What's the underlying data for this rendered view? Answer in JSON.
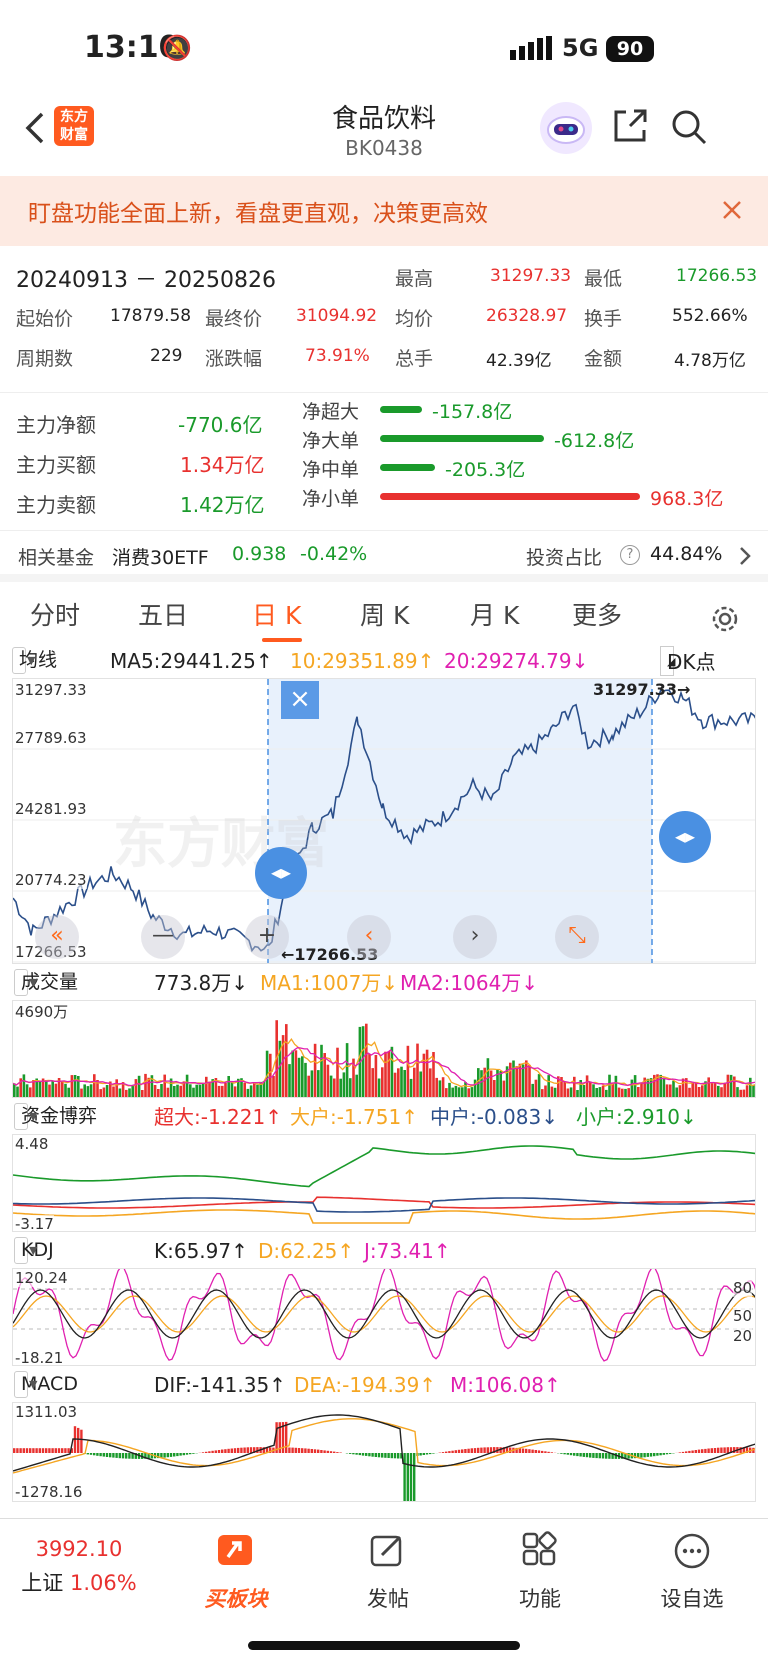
{
  "status_bar": {
    "time": "13:10",
    "network": "5G",
    "battery": "90"
  },
  "nav": {
    "title": "食品饮料",
    "code": "BK0438",
    "logo_line1": "东方",
    "logo_line2": "财富"
  },
  "banner": {
    "text": "盯盘功能全面上新，看盘更直观，决策更高效"
  },
  "stats": {
    "date_range": "20240913 － 20250826",
    "high_label": "最高",
    "high": "31297.33",
    "low_label": "最低",
    "low": "17266.53",
    "start_label": "起始价",
    "start": "17879.58",
    "end_label": "最终价",
    "end": "31094.92",
    "avg_label": "均价",
    "avg": "26328.97",
    "turnover_label": "换手",
    "turnover": "552.66%",
    "periods_label": "周期数",
    "periods": "229",
    "change_label": "涨跌幅",
    "change": "73.91%",
    "volume_label": "总手",
    "volume": "42.39亿",
    "amount_label": "金额",
    "amount": "4.78万亿"
  },
  "flows": {
    "main_net_label": "主力净额",
    "main_net": "-770.6亿",
    "main_buy_label": "主力买额",
    "main_buy": "1.34万亿",
    "main_sell_label": "主力卖额",
    "main_sell": "1.42万亿",
    "bars": [
      {
        "label": "净超大",
        "value": "-157.8亿",
        "ratio": 0.16,
        "color": "#1a9a2b"
      },
      {
        "label": "净大单",
        "value": "-612.8亿",
        "ratio": 0.63,
        "color": "#1a9a2b"
      },
      {
        "label": "净中单",
        "value": "-205.3亿",
        "ratio": 0.21,
        "color": "#1a9a2b"
      },
      {
        "label": "净小单",
        "value": "968.3亿",
        "ratio": 1.0,
        "color": "#e8312f"
      }
    ]
  },
  "fund": {
    "label": "相关基金",
    "name": "消费30ETF",
    "price": "0.938",
    "change": "-0.42%",
    "ratio_label": "投资占比",
    "ratio": "44.84%"
  },
  "tabs": [
    "分时",
    "五日",
    "日 K",
    "周 K",
    "月 K",
    "更多"
  ],
  "active_tab": "日 K",
  "main_chart": {
    "selector": "均线",
    "ma5": "MA5:29441.25↑",
    "ma10": "10:29351.89↑",
    "ma20": "20:29274.79↓",
    "dk": "DK点",
    "y_labels": [
      "31297.33",
      "27789.63",
      "24281.93",
      "20774.23",
      "17266.53"
    ],
    "peak_label": "31297.33",
    "low_label": "17266.53",
    "watermark": "东方财富",
    "close_icon": "×",
    "ctrl_labels": [
      "«",
      "—",
      "+",
      "‹",
      "›",
      "⤡"
    ]
  },
  "volume": {
    "selector": "成交量",
    "value": "773.8万↓",
    "ma1": "MA1:1007万↓",
    "ma2": "MA2:1064万↓",
    "max": "4690万"
  },
  "capital": {
    "selector": "资金博弈",
    "super": "超大:-1.221↑",
    "large": "大户:-1.751↑",
    "mid": "中户:-0.083↓",
    "small": "小户:2.910↓",
    "max": "4.48",
    "min": "-3.17"
  },
  "kdj": {
    "selector": "KDJ",
    "k": "K:65.97↑",
    "d": "D:62.25↑",
    "j": "J:73.41↑",
    "max": "120.24",
    "min": "-18.21",
    "levels": [
      "80",
      "50",
      "20"
    ]
  },
  "macd": {
    "selector": "MACD",
    "dif": "DIF:-141.35↑",
    "dea": "DEA:-194.39↑",
    "m": "M:106.08↑",
    "max": "1311.03",
    "min": "-1278.16"
  },
  "bottom": {
    "index_price": "3992.10",
    "index_name": "上证",
    "index_change": "1.06%",
    "items": [
      "买板块",
      "发帖",
      "功能",
      "设自选"
    ]
  },
  "colors": {
    "up": "#e8312f",
    "down": "#1a9a2b",
    "ma10": "#f5a623",
    "ma20": "#e020b0",
    "accent": "#ff6a1a",
    "select": "#4a90e2"
  }
}
